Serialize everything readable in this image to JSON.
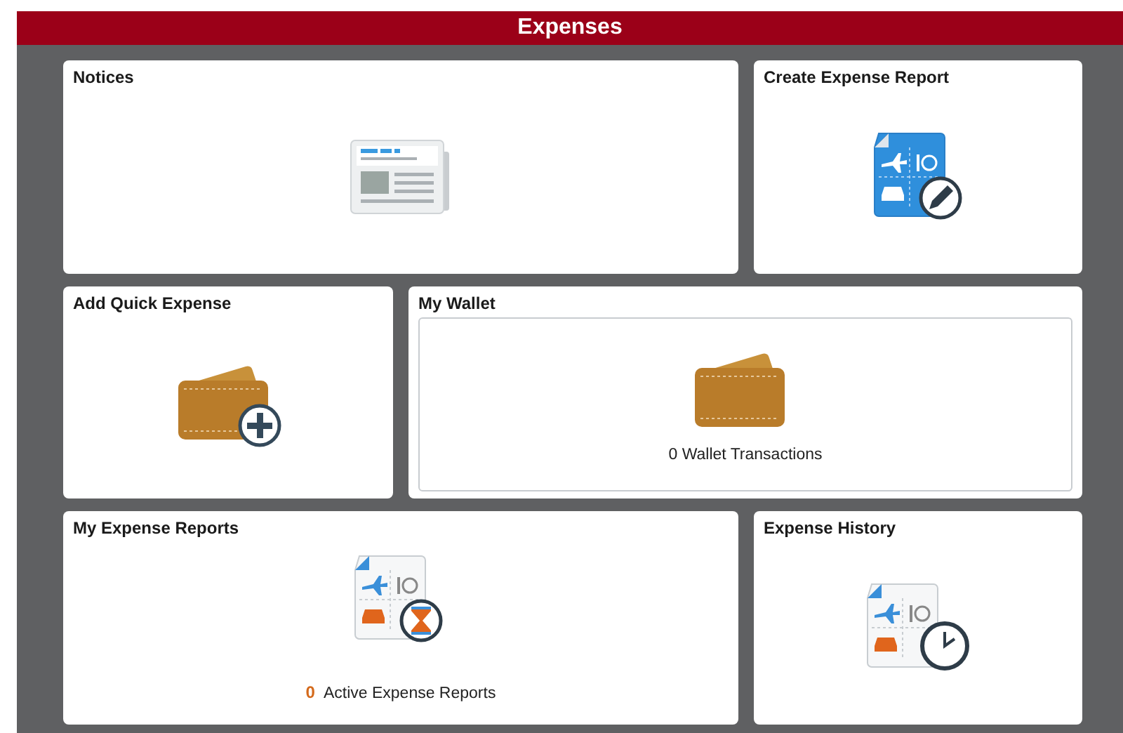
{
  "header": {
    "title": "Expenses"
  },
  "tiles": [
    {
      "kind": "notices",
      "title": "Notices"
    },
    {
      "kind": "create",
      "title": "Create Expense Report"
    },
    {
      "kind": "quick",
      "title": "Add Quick Expense"
    },
    {
      "kind": "wallet",
      "title": "My Wallet",
      "caption": "0 Wallet Transactions"
    },
    {
      "kind": "reports",
      "title": "My Expense Reports",
      "count": "0",
      "caption": "Active Expense Reports"
    },
    {
      "kind": "history",
      "title": "Expense History"
    }
  ]
}
